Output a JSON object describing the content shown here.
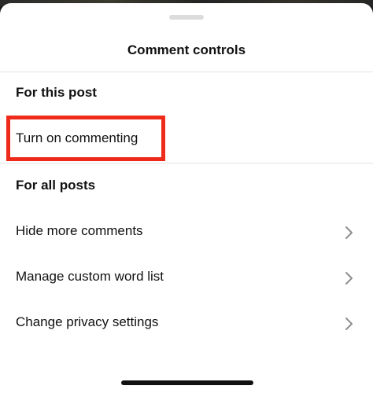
{
  "sheet": {
    "title": "Comment controls"
  },
  "sections": {
    "this_post": {
      "header": "For this post",
      "items": [
        {
          "label": "Turn on commenting"
        }
      ]
    },
    "all_posts": {
      "header": "For all posts",
      "items": [
        {
          "label": "Hide more comments",
          "icon": "chevron-right-icon"
        },
        {
          "label": "Manage custom word list",
          "icon": "chevron-right-icon"
        },
        {
          "label": "Change privacy settings",
          "icon": "chevron-right-icon"
        }
      ]
    }
  },
  "annotation": {
    "highlight_color": "#ee2a1b"
  }
}
